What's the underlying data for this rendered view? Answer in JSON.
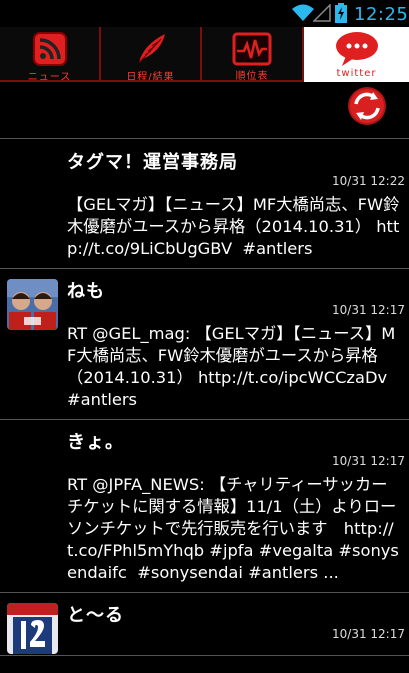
{
  "status_bar": {
    "time": "12:25",
    "icons": [
      "wifi-icon",
      "signal-icon",
      "battery-charging-icon"
    ]
  },
  "tabs": [
    {
      "label": "ニュース",
      "icon": "rss-icon",
      "selected": false
    },
    {
      "label": "日程/結果",
      "icon": "feather-icon",
      "selected": false
    },
    {
      "label": "順位表",
      "icon": "pulse-chart-icon",
      "selected": false
    },
    {
      "label": "twitter",
      "icon": "speech-bubble-icon",
      "selected": true
    }
  ],
  "toolbar": {
    "refresh_icon": "refresh-icon"
  },
  "colors": {
    "accent": "#e02020",
    "clock": "#2ab8ee",
    "divider": "#555555",
    "tab_border": "#7a0f0f"
  },
  "tweets": [
    {
      "name": "タグマ！運営事務局",
      "time": "10/31 12:22",
      "text": "【GELマガ】【ニュース】MF大橋尚志、FW鈴木優磨がユースから昇格（2014.10.31） http://t.co/9LiCbUgGBV  #antlers",
      "avatar": false
    },
    {
      "name": "ねも",
      "time": "10/31 12:17",
      "text": "RT @GEL_mag: 【GELマガ】【ニュース】MF大橋尚志、FW鈴木優磨がユースから昇格（2014.10.31） http://t.co/ipcWCCzaDv  #antlers",
      "avatar": true
    },
    {
      "name": "きょ。",
      "time": "10/31 12:17",
      "text": "RT @JPFA_NEWS: 【チャリティーサッカーチケットに関する情報】11/1（土）よりローソンチケットで先行販売を行います　http://t.co/FPhl5mYhqb #jpfa #vegalta #sonysendaifc  #sonysendai #antlers ...",
      "avatar": false
    },
    {
      "name": "と〜る",
      "time": "10/31 12:17",
      "text": "",
      "avatar": true
    }
  ]
}
